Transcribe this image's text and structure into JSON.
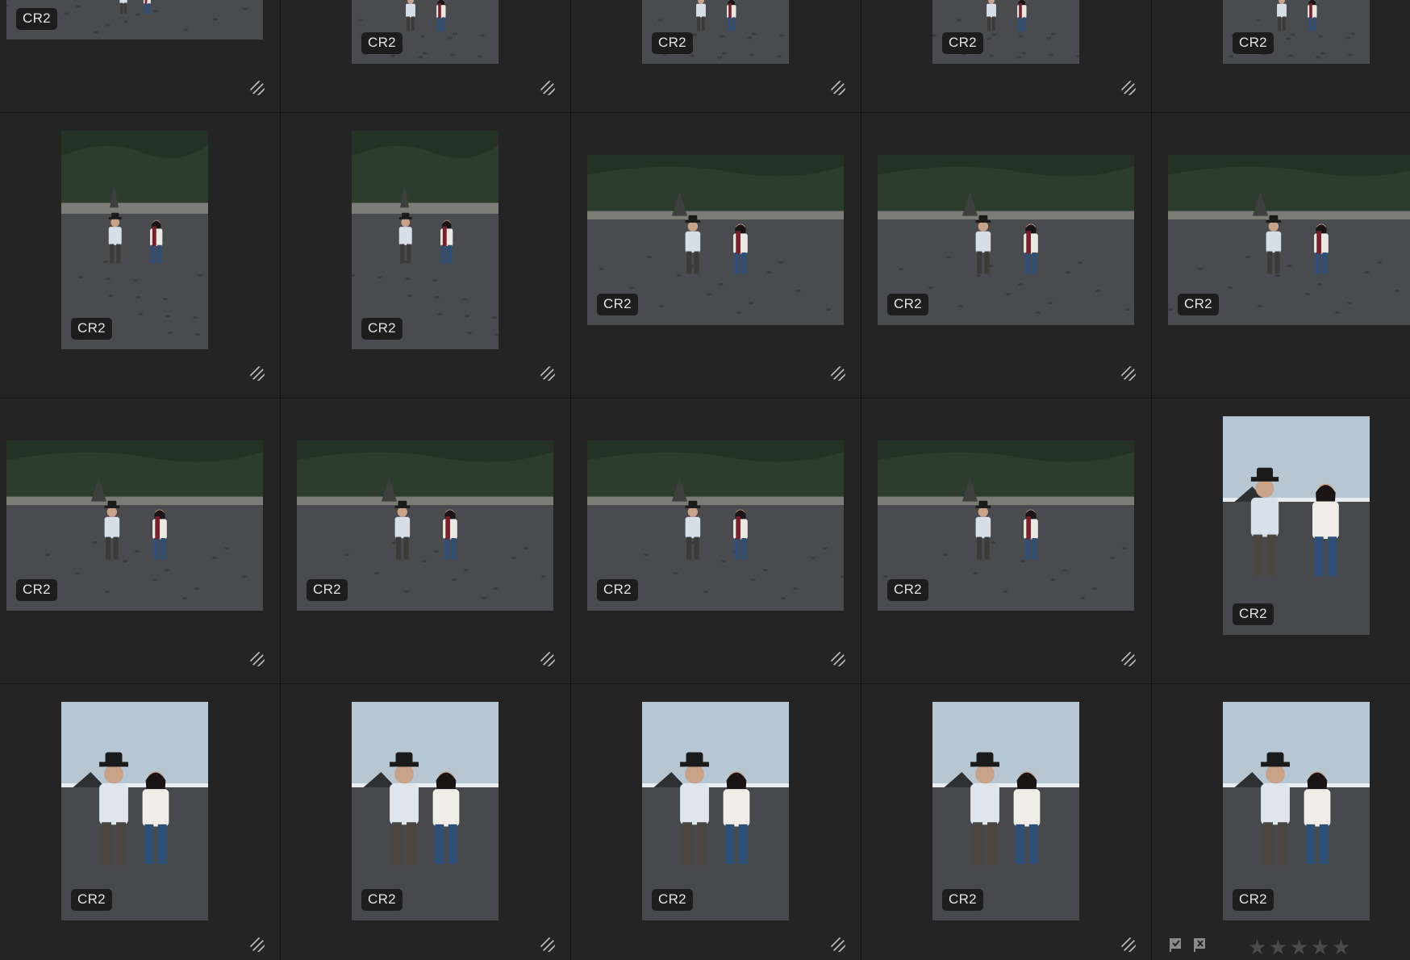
{
  "view": {
    "grid_columns": 5,
    "photos": [
      {
        "format": "CR2",
        "scene": "beach-walk",
        "orientation": "landscape"
      },
      {
        "format": "CR2",
        "scene": "beach-walk",
        "orientation": "portrait"
      },
      {
        "format": "CR2",
        "scene": "beach-walk",
        "orientation": "portrait"
      },
      {
        "format": "CR2",
        "scene": "beach-walk",
        "orientation": "portrait"
      },
      {
        "format": "CR2",
        "scene": "beach-walk",
        "orientation": "portrait"
      },
      {
        "format": "CR2",
        "scene": "beach-walk",
        "orientation": "portrait"
      },
      {
        "format": "CR2",
        "scene": "beach-walk",
        "orientation": "portrait"
      },
      {
        "format": "CR2",
        "scene": "beach-walk",
        "orientation": "landscape"
      },
      {
        "format": "CR2",
        "scene": "beach-walk",
        "orientation": "landscape"
      },
      {
        "format": "CR2",
        "scene": "beach-walk",
        "orientation": "landscape"
      },
      {
        "format": "CR2",
        "scene": "beach-walk",
        "orientation": "landscape"
      },
      {
        "format": "CR2",
        "scene": "beach-walk",
        "orientation": "landscape"
      },
      {
        "format": "CR2",
        "scene": "beach-walk",
        "orientation": "landscape"
      },
      {
        "format": "CR2",
        "scene": "beach-walk",
        "orientation": "landscape"
      },
      {
        "format": "CR2",
        "scene": "beach-ocean",
        "orientation": "portrait"
      },
      {
        "format": "CR2",
        "scene": "beach-embrace",
        "orientation": "portrait"
      },
      {
        "format": "CR2",
        "scene": "beach-embrace",
        "orientation": "portrait"
      },
      {
        "format": "CR2",
        "scene": "beach-embrace",
        "orientation": "portrait"
      },
      {
        "format": "CR2",
        "scene": "beach-embrace",
        "orientation": "portrait"
      },
      {
        "format": "CR2",
        "scene": "beach-embrace",
        "orientation": "portrait"
      }
    ]
  },
  "cell_icons": {
    "develop_icon": "develop-settings-icon",
    "flag_pick_icon": "flag-pick-icon",
    "flag_reject_icon": "flag-reject-icon",
    "star_icon": "star-icon"
  },
  "selected_cell": {
    "rating_stars": [
      "★",
      "★",
      "★",
      "★",
      "★"
    ],
    "rating_value": 0
  },
  "colors": {
    "background": "#232323",
    "badge_bg": "#141414",
    "badge_text": "#e4e4e4",
    "star_inactive": "#4a4a4a"
  }
}
